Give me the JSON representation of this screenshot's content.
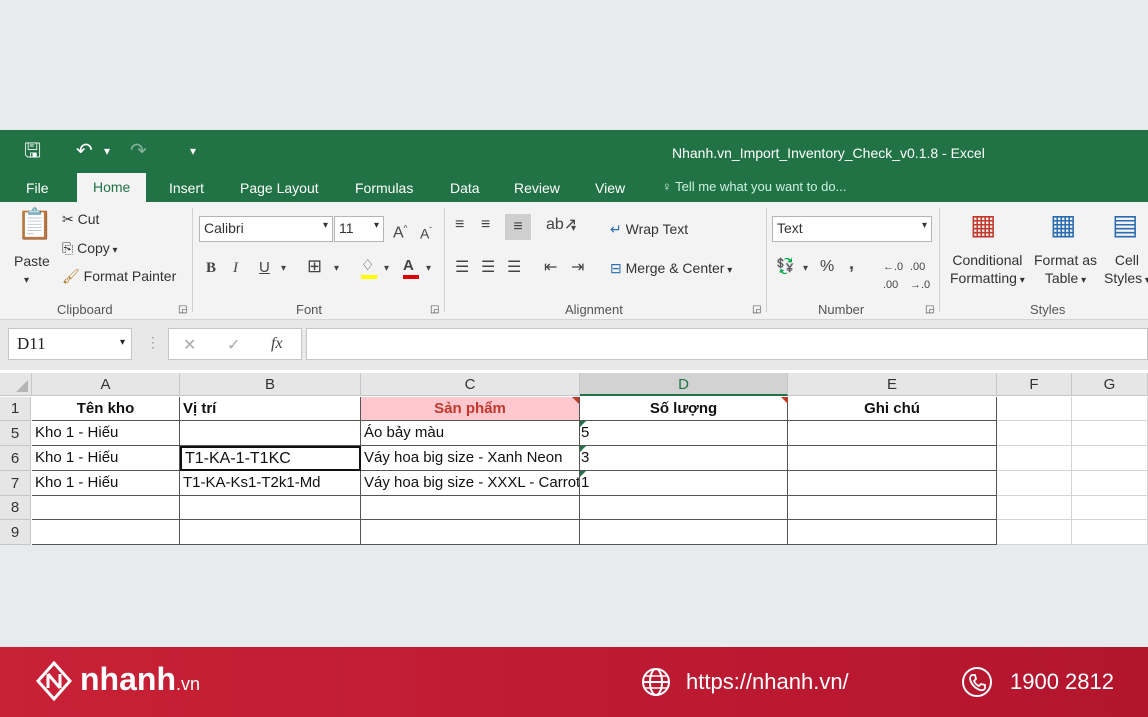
{
  "window": {
    "title": "Nhanh.vn_Import_Inventory_Check_v0.1.8 - Excel"
  },
  "tabs": [
    "File",
    "Home",
    "Insert",
    "Page Layout",
    "Formulas",
    "Data",
    "Review",
    "View"
  ],
  "tell_me": "Tell me what you want to do...",
  "clipboard": {
    "paste": "Paste",
    "cut": "Cut",
    "copy": "Copy",
    "format_painter": "Format Painter",
    "group": "Clipboard"
  },
  "font": {
    "name": "Calibri",
    "size": "11",
    "bold": "B",
    "italic": "I",
    "underline": "U",
    "group": "Font"
  },
  "alignment": {
    "wrap": "Wrap Text",
    "merge": "Merge & Center",
    "group": "Alignment"
  },
  "number": {
    "format": "Text",
    "percent": "%",
    "comma": ",",
    "group": "Number"
  },
  "styles": {
    "conditional_1": "Conditional",
    "conditional_2": "Formatting",
    "format_table_1": "Format as",
    "format_table_2": "Table",
    "cell_styles_1": "Cell",
    "cell_styles_2": "Styles",
    "group": "Styles"
  },
  "formula_bar": {
    "name_box": "D11",
    "fx": "fx",
    "value": ""
  },
  "columns": [
    "A",
    "B",
    "C",
    "D",
    "E",
    "F",
    "G"
  ],
  "rows": [
    {
      "num": "1",
      "cells": [
        "Tên kho",
        "Vị trí",
        "Sản phẩm",
        "Số lượng",
        "Ghi chú",
        "",
        ""
      ]
    },
    {
      "num": "5",
      "cells": [
        "Kho 1 - Hiếu",
        "",
        "Áo bảy màu",
        "5",
        "",
        "",
        ""
      ]
    },
    {
      "num": "6",
      "cells": [
        "Kho 1 - Hiếu",
        "T1-KA-1-T1KC",
        "Váy hoa big size - Xanh Neon",
        "3",
        "",
        "",
        ""
      ]
    },
    {
      "num": "7",
      "cells": [
        "Kho 1 - Hiếu",
        "T1-KA-Ks1-T2k1-Md",
        "Váy hoa big size - XXXL - Carrot",
        "1",
        "",
        "",
        ""
      ]
    },
    {
      "num": "8",
      "cells": [
        "",
        "",
        "",
        "",
        "",
        "",
        ""
      ]
    },
    {
      "num": "9",
      "cells": [
        "",
        "",
        "",
        "",
        "",
        "",
        ""
      ]
    }
  ],
  "colors": {
    "excel_green": "#217346",
    "header_pink": "#ffc7ce",
    "header_pink_text": "#c0392b",
    "footer_red": "#c92136"
  },
  "footer": {
    "brand": "nhanh",
    "brand_suffix": ".vn",
    "website": "https://nhanh.vn/",
    "phone": "1900 2812"
  }
}
